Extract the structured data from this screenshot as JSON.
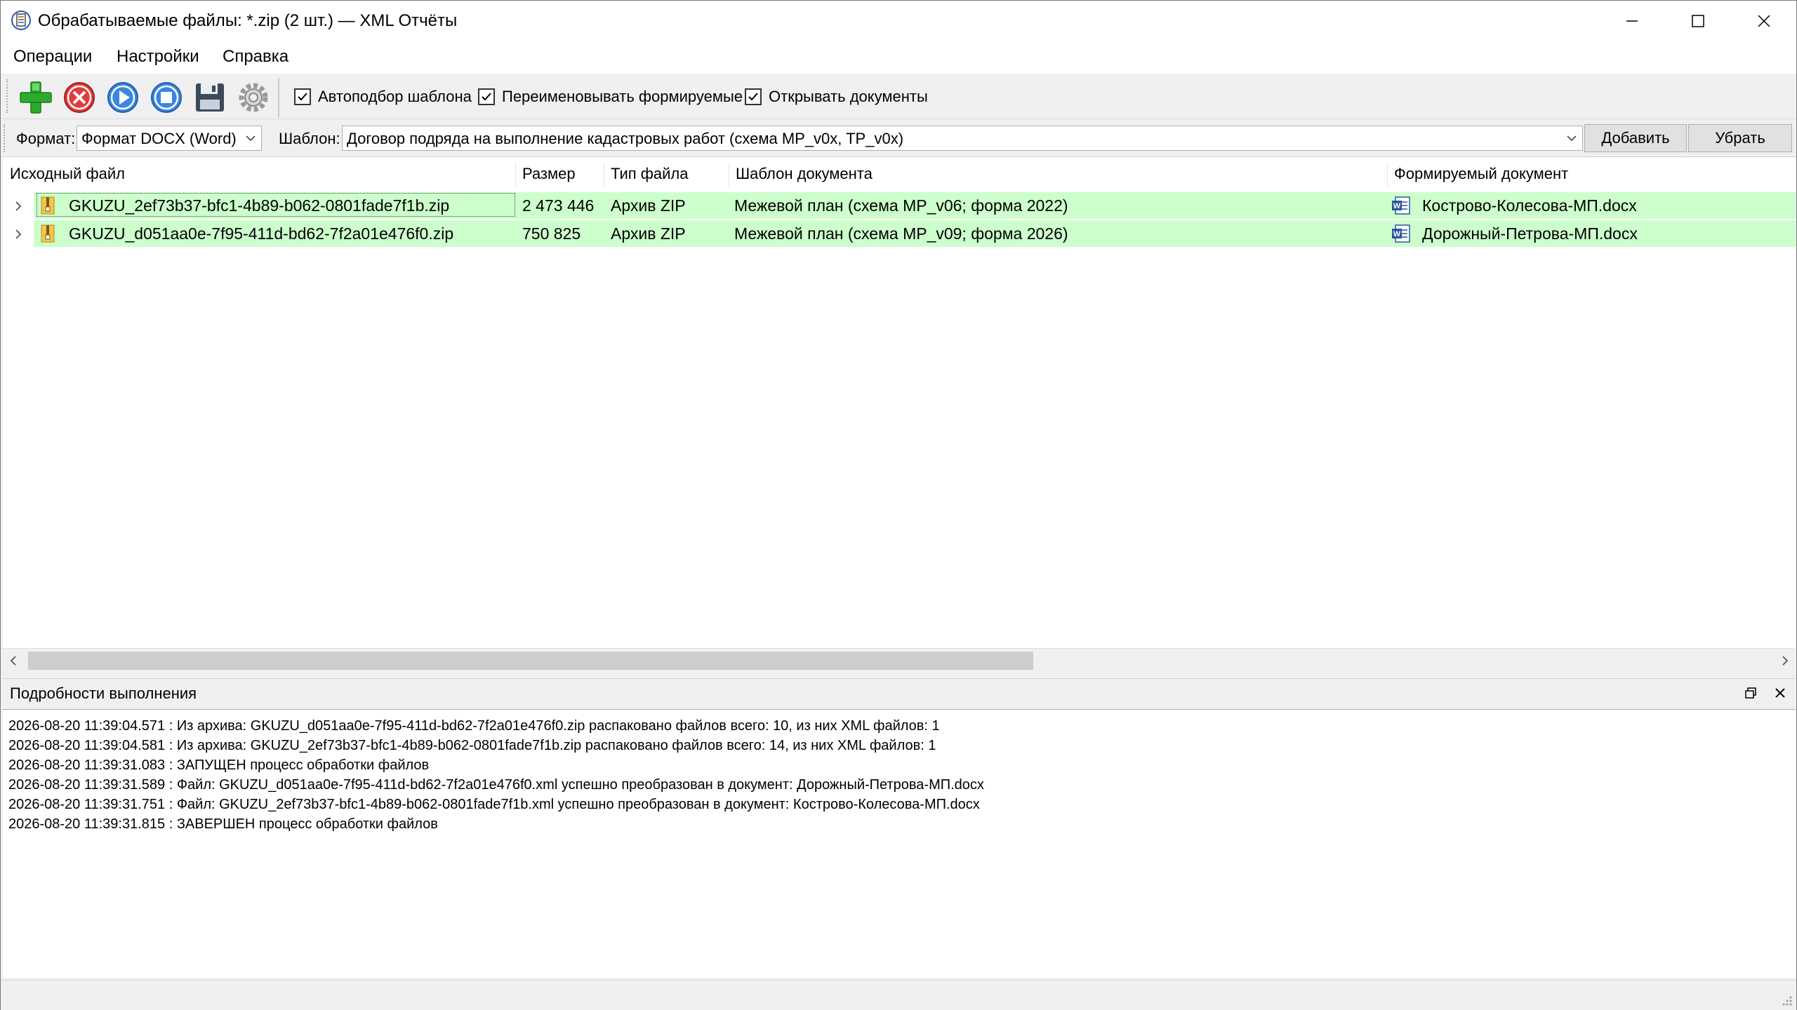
{
  "window": {
    "title": "Обрабатываемые файлы: *.zip (2 шт.) — XML Отчёты",
    "icon": "xml-app-icon"
  },
  "menu": {
    "items": [
      "Операции",
      "Настройки",
      "Справка"
    ]
  },
  "toolbar": {
    "buttons": [
      "add-icon",
      "delete-icon",
      "play-icon",
      "stop-icon",
      "save-icon",
      "settings-gear-icon"
    ],
    "checkboxes": [
      {
        "label": "Автоподбор шаблона",
        "checked": true
      },
      {
        "label": "Переименовывать формируемые",
        "checked": true
      },
      {
        "label": "Открывать документы",
        "checked": true
      }
    ]
  },
  "format_bar": {
    "format_label": "Формат:",
    "format_value": "Формат DOCX (Word)",
    "template_label": "Шаблон:",
    "template_value": "Договор подряда на выполнение кадастровых работ (схема MP_v0x, TP_v0x)",
    "add_button": "Добавить",
    "remove_button": "Убрать"
  },
  "file_list": {
    "columns": [
      "Исходный файл",
      "Размер",
      "Тип файла",
      "Шаблон документа",
      "Формируемый документ"
    ],
    "rows": [
      {
        "source": "GKUZU_2ef73b37-bfc1-4b89-b062-0801fade7f1b.zip",
        "size": "2 473 446",
        "type": "Архив ZIP",
        "template": "Межевой план (схема MP_v06; форма 2022)",
        "output": "Кострово-Колесова-МП.docx"
      },
      {
        "source": "GKUZU_d051aa0e-7f95-411d-bd62-7f2a01e476f0.zip",
        "size": "750 825",
        "type": "Архив ZIP",
        "template": "Межевой план (схема MP_v09; форма 2026)",
        "output": "Дорожный-Петрова-МП.docx"
      }
    ],
    "row_color": "#ccffcc"
  },
  "log": {
    "title": "Подробности выполнения",
    "lines": [
      "2026-08-20 11:39:04.571 : Из архива: GKUZU_d051aa0e-7f95-411d-bd62-7f2a01e476f0.zip распаковано файлов всего: 10, из них XML файлов: 1",
      "2026-08-20 11:39:04.581 : Из архива: GKUZU_2ef73b37-bfc1-4b89-b062-0801fade7f1b.zip распаковано файлов всего: 14, из них XML файлов: 1",
      "2026-08-20 11:39:31.083 : ЗАПУЩЕН процесс обработки файлов",
      "2026-08-20 11:39:31.589 : Файл: GKUZU_d051aa0e-7f95-411d-bd62-7f2a01e476f0.xml успешно преобразован в документ: Дорожный-Петрова-МП.docx",
      "2026-08-20 11:39:31.751 : Файл: GKUZU_2ef73b37-bfc1-4b89-b062-0801fade7f1b.xml успешно преобразован в документ: Кострово-Колесова-МП.docx",
      "2026-08-20 11:39:31.815 : ЗАВЕРШЕН процесс обработки файлов"
    ]
  }
}
